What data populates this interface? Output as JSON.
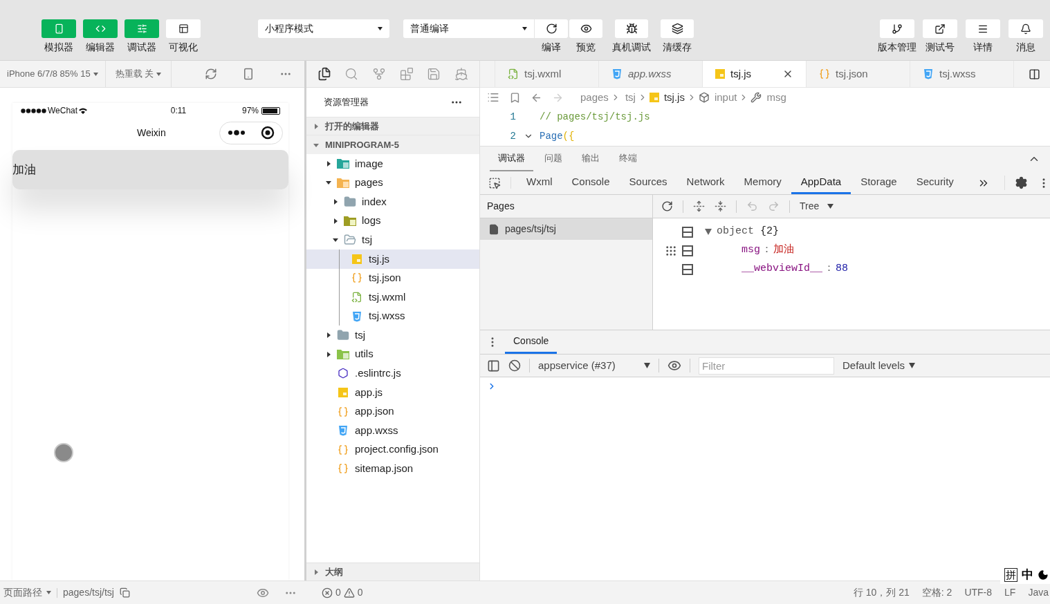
{
  "toolbar": {
    "view_toggles": [
      {
        "label": "模拟器",
        "on": true
      },
      {
        "label": "编辑器",
        "on": true
      },
      {
        "label": "调试器",
        "on": true
      },
      {
        "label": "可视化",
        "on": false
      }
    ],
    "mode_select": "小程序模式",
    "compile_select": "普通编译",
    "actions": [
      {
        "label": "编译"
      },
      {
        "label": "预览"
      },
      {
        "label": "真机调试"
      },
      {
        "label": "清缓存"
      }
    ],
    "right_actions": [
      {
        "label": "版本管理"
      },
      {
        "label": "测试号"
      },
      {
        "label": "详情"
      },
      {
        "label": "消息"
      }
    ]
  },
  "simulator": {
    "device": "iPhone 6/7/8 85% 15",
    "hot_reload": "热重载 关",
    "phone": {
      "carrier": "WeChat",
      "time": "0:11",
      "battery": "97%",
      "title": "Weixin",
      "content": "加油"
    }
  },
  "explorer": {
    "activity_icons": [
      {
        "selected": true
      },
      {
        "selected": false
      },
      {
        "selected": false
      },
      {
        "selected": false
      },
      {
        "selected": false
      },
      {
        "selected": false
      }
    ],
    "title": "资源管理器",
    "open_editors": {
      "label": "打开的编辑器",
      "expanded": false
    },
    "project": {
      "label": "MINIPROGRAM-5",
      "expanded": true
    },
    "tree": [
      {
        "name": "image",
        "kind": "folder-image",
        "expanded": false,
        "selected": false
      },
      {
        "name": "pages",
        "kind": "folder-pages",
        "expanded": true,
        "selected": false,
        "children": [
          {
            "name": "index",
            "kind": "folder",
            "expanded": false,
            "selected": false
          },
          {
            "name": "logs",
            "kind": "folder-logs",
            "expanded": false,
            "selected": false
          },
          {
            "name": "tsj",
            "kind": "folder",
            "expanded": true,
            "selected": false,
            "children": [
              {
                "name": "tsj.js",
                "kind": "js",
                "selected": true
              },
              {
                "name": "tsj.json",
                "kind": "json",
                "selected": false
              },
              {
                "name": "tsj.wxml",
                "kind": "wxml",
                "selected": false
              },
              {
                "name": "tsj.wxss",
                "kind": "wxss",
                "selected": false
              }
            ]
          }
        ]
      },
      {
        "name": "tsj",
        "kind": "folder",
        "expanded": false,
        "selected": false
      },
      {
        "name": "utils",
        "kind": "folder-utils",
        "expanded": false,
        "selected": false
      },
      {
        "name": ".eslintrc.js",
        "kind": "eslint",
        "selected": false
      },
      {
        "name": "app.js",
        "kind": "js",
        "selected": false
      },
      {
        "name": "app.json",
        "kind": "json",
        "selected": false
      },
      {
        "name": "app.wxss",
        "kind": "wxss",
        "selected": false
      },
      {
        "name": "project.config.json",
        "kind": "json",
        "selected": false
      },
      {
        "name": "sitemap.json",
        "kind": "json",
        "selected": false
      }
    ],
    "outline": {
      "label": "大纲",
      "expanded": false
    }
  },
  "editor": {
    "tabs": [
      {
        "label": "tsj.wxml",
        "kind": "wxml",
        "selected": false,
        "preview": false
      },
      {
        "label": "app.wxss",
        "kind": "wxss",
        "selected": false,
        "preview": true
      },
      {
        "label": "tsj.js",
        "kind": "js",
        "selected": true,
        "preview": false
      },
      {
        "label": "tsj.json",
        "kind": "json",
        "selected": false,
        "preview": false
      },
      {
        "label": "tsj.wxss",
        "kind": "wxss",
        "selected": false,
        "preview": false
      }
    ],
    "breadcrumb": [
      {
        "text": "pages",
        "kind": "folder"
      },
      {
        "text": "tsj",
        "kind": "folder"
      },
      {
        "text": "tsj.js",
        "kind": "js"
      },
      {
        "text": "input",
        "kind": "method"
      },
      {
        "text": "msg",
        "kind": "property"
      }
    ],
    "lines": [
      {
        "number": "1",
        "tokens": [
          {
            "text": "// pages/tsj/tsj.js",
            "kind": "comment"
          }
        ]
      },
      {
        "number": "2",
        "expanded": true,
        "tokens": [
          {
            "text": "Page",
            "kind": "function"
          },
          {
            "text": "({",
            "kind": "brace"
          }
        ]
      }
    ]
  },
  "devtools": {
    "tabs": [
      {
        "label": "调试器",
        "selected": true
      },
      {
        "label": "问题",
        "selected": false
      },
      {
        "label": "输出",
        "selected": false
      },
      {
        "label": "终端",
        "selected": false
      }
    ],
    "panels": [
      {
        "label": "Wxml",
        "selected": false
      },
      {
        "label": "Console",
        "selected": false
      },
      {
        "label": "Sources",
        "selected": false
      },
      {
        "label": "Network",
        "selected": false
      },
      {
        "label": "Memory",
        "selected": false
      },
      {
        "label": "AppData",
        "selected": true
      },
      {
        "label": "Storage",
        "selected": false
      },
      {
        "label": "Security",
        "selected": false
      }
    ],
    "pages_header": "Pages",
    "pages": [
      {
        "label": "pages/tsj/tsj",
        "selected": true
      }
    ],
    "view_mode": "Tree",
    "data": {
      "label": "object",
      "count": "{2}",
      "expanded": true,
      "separator": "：",
      "fields": [
        {
          "key": "msg",
          "value": "加油",
          "kind": "string"
        },
        {
          "key": "__webviewId__",
          "value": "88",
          "kind": "number"
        }
      ]
    },
    "console": {
      "tab": "Console",
      "selected": true,
      "context": "appservice (#37)",
      "filter_placeholder": "Filter",
      "levels": "Default levels"
    }
  },
  "status_bar": {
    "page_path_label": "页面路径",
    "page_path": "pages/tsj/tsj",
    "errors": "0",
    "warnings": "0",
    "items": [
      "行 10，列 21",
      "空格: 2",
      "UTF-8",
      "LF",
      "Java"
    ],
    "ime": [
      "拼",
      "中"
    ]
  }
}
